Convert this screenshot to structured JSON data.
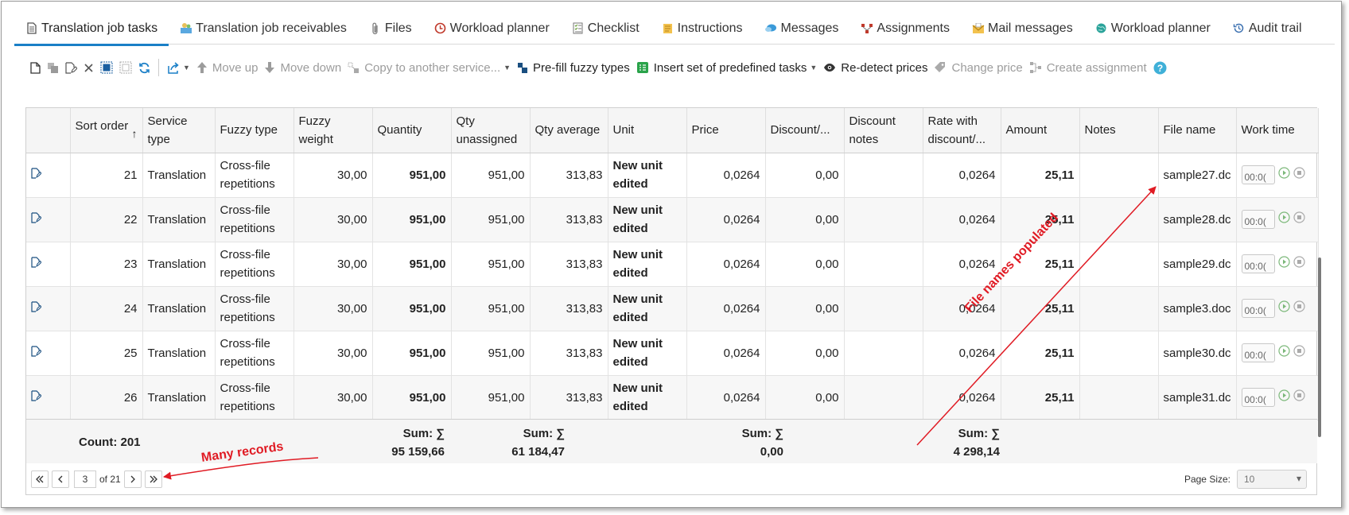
{
  "tabs": [
    {
      "label": "Translation job tasks",
      "icon": "document-icon",
      "color": "#555555"
    },
    {
      "label": "Translation job receivables",
      "icon": "receivables-icon",
      "color": "#3a9ad9"
    },
    {
      "label": "Files",
      "icon": "paperclip-icon",
      "color": "#777777"
    },
    {
      "label": "Workload planner",
      "icon": "clock-icon",
      "color": "#c0392b"
    },
    {
      "label": "Checklist",
      "icon": "checklist-icon",
      "color": "#6a9f3a"
    },
    {
      "label": "Instructions",
      "icon": "instructions-icon",
      "color": "#e0a21b"
    },
    {
      "label": "Messages",
      "icon": "messages-icon",
      "color": "#3a9ad9"
    },
    {
      "label": "Assignments",
      "icon": "assignments-icon",
      "color": "#c0392b"
    },
    {
      "label": "Mail messages",
      "icon": "mail-icon",
      "color": "#e0a21b"
    },
    {
      "label": "Workload planner",
      "icon": "globe-icon",
      "color": "#2aa39a"
    },
    {
      "label": "Audit trail",
      "icon": "history-icon",
      "color": "#3a6fb0"
    }
  ],
  "toolbar": {
    "move_up": "Move up",
    "move_down": "Move down",
    "copy_service": "Copy to another service...",
    "prefill": "Pre-fill fuzzy types",
    "insert_set": "Insert set of predefined tasks",
    "redetect": "Re-detect prices",
    "change_price": "Change price",
    "create_assignment": "Create assignment"
  },
  "columns": [
    "",
    "Sort order",
    "Service type",
    "Fuzzy type",
    "Fuzzy weight",
    "Quantity",
    "Qty unassigned",
    "Qty average",
    "Unit",
    "Price",
    "Discount/...",
    "Discount notes",
    "Rate with discount/...",
    "Amount",
    "Notes",
    "File name",
    "Work time"
  ],
  "rows": [
    {
      "sort": "21",
      "service": "Translation",
      "fuzzy": "Cross-file repetitions",
      "weight": "30,00",
      "qty": "951,00",
      "unassigned": "951,00",
      "avg": "313,83",
      "unit": "New unit edited",
      "price": "0,0264",
      "discount": "0,00",
      "dnotes": "",
      "rate": "0,0264",
      "amount": "25,11",
      "notes": "",
      "file": "sample27.dc",
      "time": "00:0("
    },
    {
      "sort": "22",
      "service": "Translation",
      "fuzzy": "Cross-file repetitions",
      "weight": "30,00",
      "qty": "951,00",
      "unassigned": "951,00",
      "avg": "313,83",
      "unit": "New unit edited",
      "price": "0,0264",
      "discount": "0,00",
      "dnotes": "",
      "rate": "0,0264",
      "amount": "25,11",
      "notes": "",
      "file": "sample28.dc",
      "time": "00:0("
    },
    {
      "sort": "23",
      "service": "Translation",
      "fuzzy": "Cross-file repetitions",
      "weight": "30,00",
      "qty": "951,00",
      "unassigned": "951,00",
      "avg": "313,83",
      "unit": "New unit edited",
      "price": "0,0264",
      "discount": "0,00",
      "dnotes": "",
      "rate": "0,0264",
      "amount": "25,11",
      "notes": "",
      "file": "sample29.dc",
      "time": "00:0("
    },
    {
      "sort": "24",
      "service": "Translation",
      "fuzzy": "Cross-file repetitions",
      "weight": "30,00",
      "qty": "951,00",
      "unassigned": "951,00",
      "avg": "313,83",
      "unit": "New unit edited",
      "price": "0,0264",
      "discount": "0,00",
      "dnotes": "",
      "rate": "0,0264",
      "amount": "25,11",
      "notes": "",
      "file": "sample3.doc",
      "time": "00:0("
    },
    {
      "sort": "25",
      "service": "Translation",
      "fuzzy": "Cross-file repetitions",
      "weight": "30,00",
      "qty": "951,00",
      "unassigned": "951,00",
      "avg": "313,83",
      "unit": "New unit edited",
      "price": "0,0264",
      "discount": "0,00",
      "dnotes": "",
      "rate": "0,0264",
      "amount": "25,11",
      "notes": "",
      "file": "sample30.dc",
      "time": "00:0("
    },
    {
      "sort": "26",
      "service": "Translation",
      "fuzzy": "Cross-file repetitions",
      "weight": "30,00",
      "qty": "951,00",
      "unassigned": "951,00",
      "avg": "313,83",
      "unit": "New unit edited",
      "price": "0,0264",
      "discount": "0,00",
      "dnotes": "",
      "rate": "0,0264",
      "amount": "25,11",
      "notes": "",
      "file": "sample31.dc",
      "time": "00:0("
    }
  ],
  "footer": {
    "count": "Count: 201",
    "sum_label": "Sum: ∑",
    "sum_quantity": "95 159,66",
    "sum_avg": "61 184,47",
    "sum_discount": "0,00",
    "sum_amount": "4 298,14"
  },
  "pager": {
    "page": "3",
    "of": "of 21",
    "page_size_label": "Page Size:",
    "page_size": "10"
  },
  "annotations": {
    "file_names": "File names populated",
    "many_records": "Many records",
    "color": "#e01b24"
  }
}
